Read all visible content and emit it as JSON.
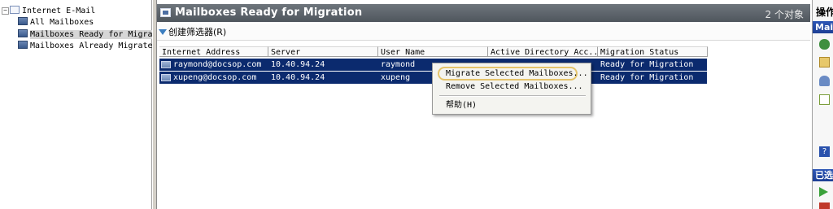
{
  "tree": {
    "root_label": "Internet E-Mail",
    "items": [
      {
        "label": "All Mailboxes"
      },
      {
        "label": "Mailboxes Ready for Migration"
      },
      {
        "label": "Mailboxes Already Migrated"
      }
    ]
  },
  "header": {
    "title": "Mailboxes Ready for Migration",
    "object_count": "2 个对象"
  },
  "toolbar": {
    "create_filter_label": "创建筛选器(R)"
  },
  "grid": {
    "columns": [
      "Internet Address",
      "Server",
      "User Name",
      "Active Directory Acc...",
      "Migration Status"
    ],
    "rows": [
      {
        "address": "raymond@docsop.com",
        "server": "10.40.94.24",
        "user": "raymond",
        "ad_account": "",
        "status": "Ready for Migration"
      },
      {
        "address": "xupeng@docsop.com",
        "server": "10.40.94.24",
        "user": "xupeng",
        "ad_account": "",
        "status": "Ready for Migration"
      }
    ]
  },
  "context_menu": {
    "items": [
      {
        "label": "Migrate Selected Mailboxes..."
      },
      {
        "label": "Remove Selected Mailboxes..."
      },
      {
        "label": "帮助(H)"
      }
    ]
  },
  "actions": {
    "title": "操作",
    "section1": "Mai",
    "section2": "已选"
  },
  "colors": {
    "selection": "#0b2a6e",
    "banner": "#5a6168",
    "highlight_ring": "#e5c46b",
    "actions_bar": "#2a52ad"
  }
}
